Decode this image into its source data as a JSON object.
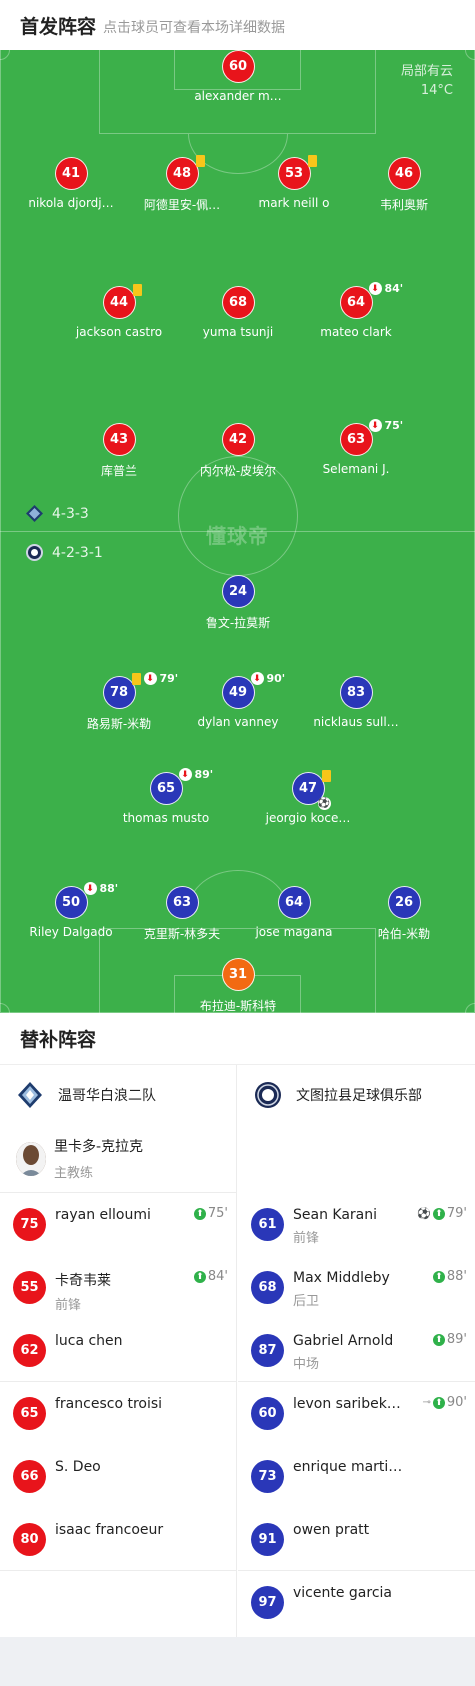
{
  "header": {
    "title": "首发阵容",
    "subtitle": "点击球员可查看本场详细数据"
  },
  "weather": {
    "condition": "局部有云",
    "temp": "14°C"
  },
  "watermark": "懂球帝",
  "formations": {
    "home": "4-3-3",
    "away": "4-2-3-1"
  },
  "home_players": [
    {
      "num": "60",
      "name": "alexander m…"
    },
    {
      "num": "41",
      "name": "nikola djordj…"
    },
    {
      "num": "48",
      "name": "阿德里安-佩…"
    },
    {
      "num": "53",
      "name": "mark neill o"
    },
    {
      "num": "46",
      "name": "韦利奥斯"
    },
    {
      "num": "44",
      "name": "jackson castro"
    },
    {
      "num": "68",
      "name": "yuma tsunji"
    },
    {
      "num": "64",
      "name": "mateo clark",
      "sub_minute": "84'"
    },
    {
      "num": "43",
      "name": "库普兰"
    },
    {
      "num": "42",
      "name": "内尔松-皮埃尔"
    },
    {
      "num": "63",
      "name": "Selemani J.",
      "sub_minute": "75'"
    }
  ],
  "away_players": [
    {
      "num": "24",
      "name": "鲁文-拉莫斯"
    },
    {
      "num": "78",
      "name": "路易斯-米勒",
      "sub_minute": "79'"
    },
    {
      "num": "49",
      "name": "dylan vanney",
      "sub_minute": "90'"
    },
    {
      "num": "83",
      "name": "nicklaus sull…"
    },
    {
      "num": "65",
      "name": "thomas musto",
      "sub_minute": "89'"
    },
    {
      "num": "47",
      "name": "jeorgio koce…"
    },
    {
      "num": "50",
      "name": "Riley Dalgado",
      "sub_minute": "88'"
    },
    {
      "num": "63",
      "name": "克里斯-林多夫"
    },
    {
      "num": "64",
      "name": "jose magana"
    },
    {
      "num": "26",
      "name": "哈伯-米勒"
    },
    {
      "num": "31",
      "name": "布拉迪-斯科特"
    }
  ],
  "subs": {
    "title": "替补阵容",
    "home": {
      "team": "温哥华白浪二队",
      "coach": {
        "name": "里卡多-克拉克",
        "role": "主教练"
      },
      "players": [
        {
          "num": "75",
          "name": "rayan elloumi",
          "minute": "75'"
        },
        {
          "num": "55",
          "name": "卡奇韦莱",
          "pos": "前锋",
          "minute": "84'"
        },
        {
          "num": "62",
          "name": "luca chen"
        },
        {
          "num": "65",
          "name": "francesco troisi"
        },
        {
          "num": "66",
          "name": "S. Deo"
        },
        {
          "num": "80",
          "name": "isaac francoeur"
        }
      ]
    },
    "away": {
      "team": "文图拉县足球俱乐部",
      "players": [
        {
          "num": "61",
          "name": "Sean Karani",
          "pos": "前锋",
          "minute": "79'"
        },
        {
          "num": "68",
          "name": "Max Middleby",
          "pos": "后卫",
          "minute": "88'"
        },
        {
          "num": "87",
          "name": "Gabriel Arnold",
          "pos": "中场",
          "minute": "89'"
        },
        {
          "num": "60",
          "name": "levon saribek…",
          "minute": "90'"
        },
        {
          "num": "73",
          "name": "enrique marti…"
        },
        {
          "num": "91",
          "name": "owen pratt"
        },
        {
          "num": "97",
          "name": "vicente garcia"
        }
      ]
    }
  },
  "colors": {
    "home": "#e8141b",
    "away": "#2a37b8",
    "keeper_away": "#f26a12",
    "pitch": "#3cb04a"
  }
}
